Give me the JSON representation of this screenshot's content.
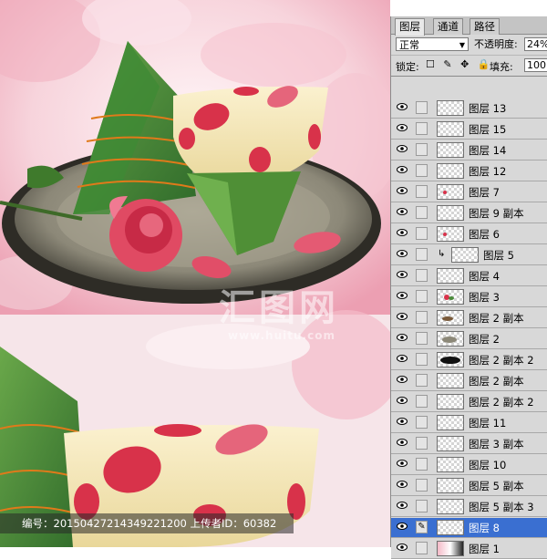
{
  "watermark": {
    "title": "汇图网",
    "url": "www.huitu.com",
    "corner": "汇图"
  },
  "meta": {
    "text": "编号：20150427214349221200 上传者ID：60382"
  },
  "panel": {
    "tabs": [
      "图层",
      "通道",
      "路径"
    ],
    "active_tab": 0,
    "blend_mode": "正常",
    "opacity_label": "不透明度:",
    "opacity_value": "24%",
    "lock_label": "锁定:",
    "lock_icons": "☐ ✎ ✥ 🔒",
    "fill_label": "填充:",
    "fill_value": "100",
    "layers": [
      {
        "name": "图层 13",
        "thumb": "empty"
      },
      {
        "name": "图层 15",
        "thumb": "empty"
      },
      {
        "name": "图层 14",
        "thumb": "empty"
      },
      {
        "name": "图层 12",
        "thumb": "empty"
      },
      {
        "name": "图层 7",
        "thumb": "red-dot"
      },
      {
        "name": "图层 9 副本",
        "thumb": "empty"
      },
      {
        "name": "图层 6",
        "thumb": "red-dot"
      },
      {
        "name": "图层 5",
        "thumb": "empty",
        "clipped": true
      },
      {
        "name": "图层 4",
        "thumb": "empty"
      },
      {
        "name": "图层 3",
        "thumb": "rose"
      },
      {
        "name": "图层 2 副本",
        "thumb": "brown"
      },
      {
        "name": "图层 2",
        "thumb": "plate"
      },
      {
        "name": "图层 2 副本 2",
        "thumb": "shadow"
      },
      {
        "name": "图层 2 副本",
        "thumb": "empty"
      },
      {
        "name": "图层 2 副本 2",
        "thumb": "empty"
      },
      {
        "name": "图层 11",
        "thumb": "empty"
      },
      {
        "name": "图层 3 副本",
        "thumb": "empty"
      },
      {
        "name": "图层 10",
        "thumb": "empty"
      },
      {
        "name": "图层 5 副本",
        "thumb": "empty"
      },
      {
        "name": "图层 5 副本 3",
        "thumb": "empty"
      },
      {
        "name": "图层 8",
        "thumb": "empty",
        "selected": true
      },
      {
        "name": "图层 1",
        "thumb": "photo"
      }
    ]
  },
  "colors": {
    "panel_bg": "#d8d8d8",
    "selected": "#3a6fd1",
    "leaf_green": "#4a8a3a",
    "rose_red": "#d8324a"
  }
}
